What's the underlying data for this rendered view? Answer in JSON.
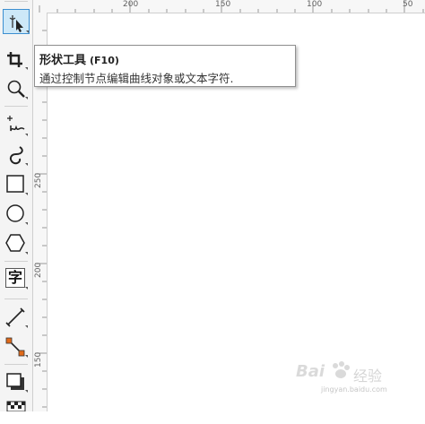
{
  "tooltip": {
    "title": "形状工具",
    "shortcut": "(F10)",
    "description": "通过控制节点编辑曲线对象或文本字符."
  },
  "text_tool_glyph": "字",
  "ruler": {
    "horizontal": [
      "200",
      "150",
      "100",
      "50"
    ],
    "vertical": [
      "250",
      "200",
      "150"
    ]
  },
  "colors": {
    "active_tool_bg": "#cde8f8",
    "active_tool_border": "#3c8fd0",
    "connector_node": "#e06a1a"
  },
  "watermark": {
    "brand": "Bai",
    "brand2": "经验",
    "url": "jingyan.baidu.com"
  }
}
